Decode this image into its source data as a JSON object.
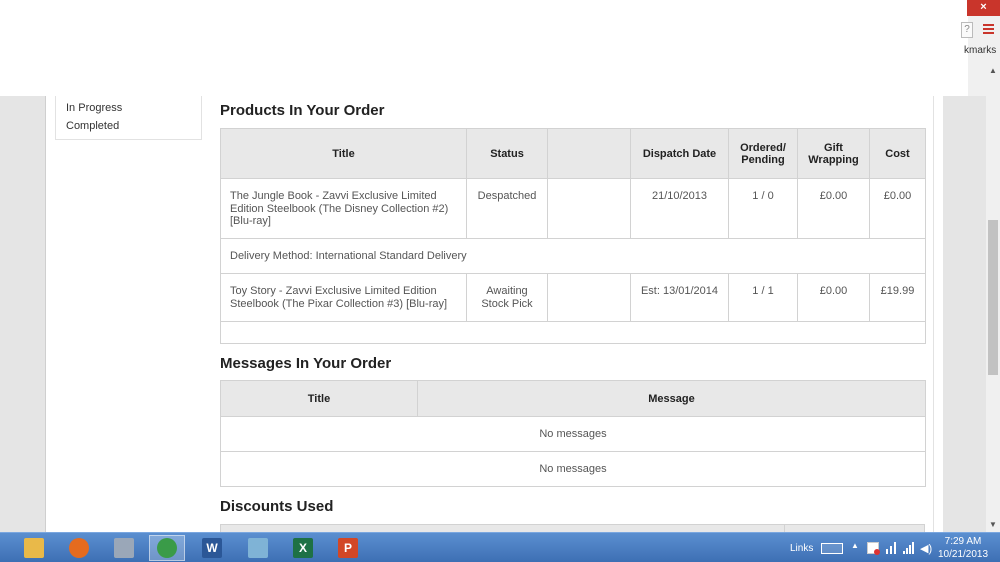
{
  "browser": {
    "close_label": "×",
    "bookmarks_label": "kmarks",
    "small_icon_label": "?"
  },
  "sidebar": {
    "items": [
      {
        "label": "In Progress"
      },
      {
        "label": "Completed"
      }
    ]
  },
  "products": {
    "heading": "Products In Your Order",
    "columns": [
      "Title",
      "Status",
      "",
      "Dispatch Date",
      "Ordered/ Pending",
      "Gift Wrapping",
      "Cost"
    ],
    "rows": [
      {
        "title": "The Jungle Book - Zavvi Exclusive Limited Edition Steelbook (The Disney Collection #2) [Blu-ray]",
        "status": "Despatched",
        "extra": "",
        "dispatch_date": "21/10/2013",
        "ordered_pending": "1 / 0",
        "gift_wrapping": "£0.00",
        "cost": "£0.00"
      },
      {
        "title": "Toy Story - Zavvi Exclusive Limited Edition Steelbook (The Pixar Collection #3) [Blu-ray]",
        "status": "Awaiting Stock Pick",
        "extra": "",
        "dispatch_date": "Est: 13/01/2014",
        "ordered_pending": "1 / 1",
        "gift_wrapping": "£0.00",
        "cost": "£19.99"
      }
    ],
    "delivery_method": "Delivery Method: International Standard Delivery"
  },
  "messages": {
    "heading": "Messages In Your Order",
    "columns": [
      "Title",
      "Message"
    ],
    "rows": [
      {
        "text": "No messages"
      },
      {
        "text": "No messages"
      }
    ]
  },
  "discounts": {
    "heading": "Discounts Used"
  },
  "taskbar": {
    "apps": [
      {
        "name": "file-explorer-icon",
        "color": "#e9b949",
        "glyph": ""
      },
      {
        "name": "firefox-icon",
        "color": "#e56b1f",
        "glyph": ""
      },
      {
        "name": "calculator-icon",
        "color": "#9aa7b8",
        "glyph": ""
      },
      {
        "name": "chrome-icon",
        "color": "#3a9b48",
        "glyph": ""
      },
      {
        "name": "word-icon",
        "color": "#2b5797",
        "glyph": "W"
      },
      {
        "name": "notes-icon",
        "color": "#7fb3d6",
        "glyph": ""
      },
      {
        "name": "excel-icon",
        "color": "#1e7145",
        "glyph": "X"
      },
      {
        "name": "powerpoint-icon",
        "color": "#d24726",
        "glyph": "P"
      }
    ],
    "links_label": "Links",
    "time": "7:29 AM",
    "date": "10/21/2013"
  }
}
